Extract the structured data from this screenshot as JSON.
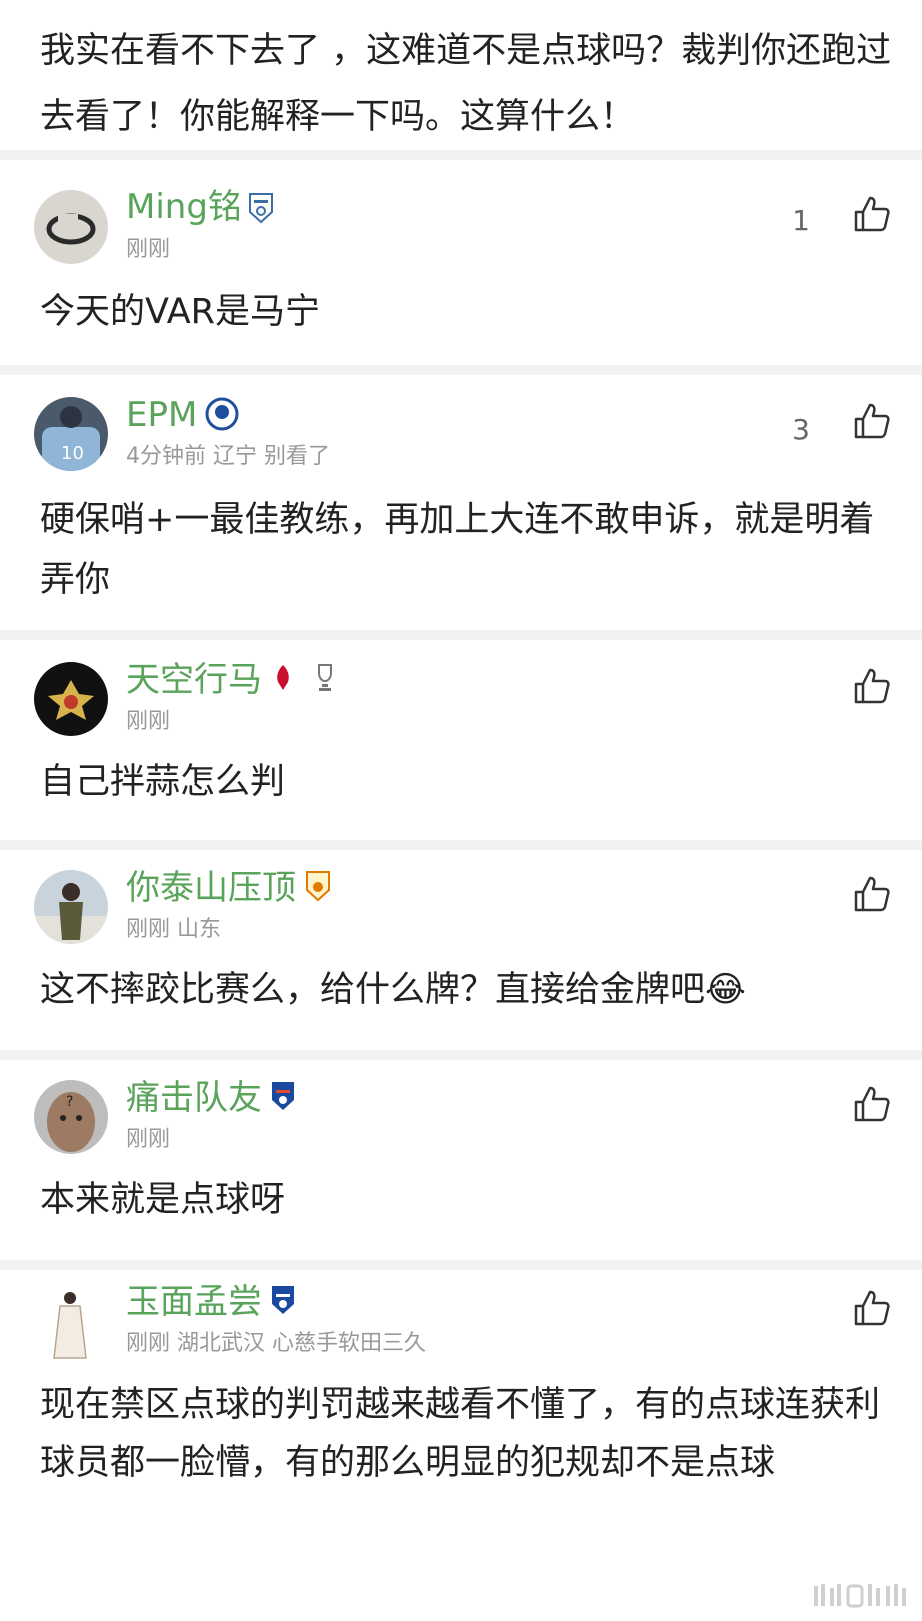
{
  "top_comment": {
    "text": "我实在看不下去了 ，这难道不是点球吗？裁判你还跑过去看了！你能解释一下吗。这算什么！"
  },
  "comments": [
    {
      "username": "Ming铭",
      "meta": "刚刚",
      "likes": "1",
      "text": "今天的VAR是马宁"
    },
    {
      "username": "EPM",
      "meta": "4分钟前 辽宁 别看了",
      "likes": "3",
      "text": "硬保哨+一最佳教练，再加上大连不敢申诉，就是明着弄你"
    },
    {
      "username": "天空行马",
      "meta": "刚刚",
      "likes": "",
      "text": "自己拌蒜怎么判"
    },
    {
      "username": "你泰山压顶",
      "meta": "刚刚 山东",
      "likes": "",
      "text": "这不摔跤比赛么，给什么牌？直接给金牌吧😂"
    },
    {
      "username": "痛击队友",
      "meta": "刚刚",
      "likes": "",
      "text": "本来就是点球呀"
    },
    {
      "username": "玉面孟尝",
      "meta": "刚刚 湖北武汉 心慈手软田三久",
      "likes": "",
      "text": "现在禁区点球的判罚越来越看不懂了，有的点球连获利球员都一脸懵，有的那么明显的犯规却不是点球"
    }
  ],
  "colors": {
    "username": "#5aa35a",
    "meta": "#999999",
    "separator": "#f2f2f2",
    "text": "#222222"
  },
  "icons": [
    "thumbs-up-icon",
    "team-badge-icon",
    "avatar-image"
  ]
}
